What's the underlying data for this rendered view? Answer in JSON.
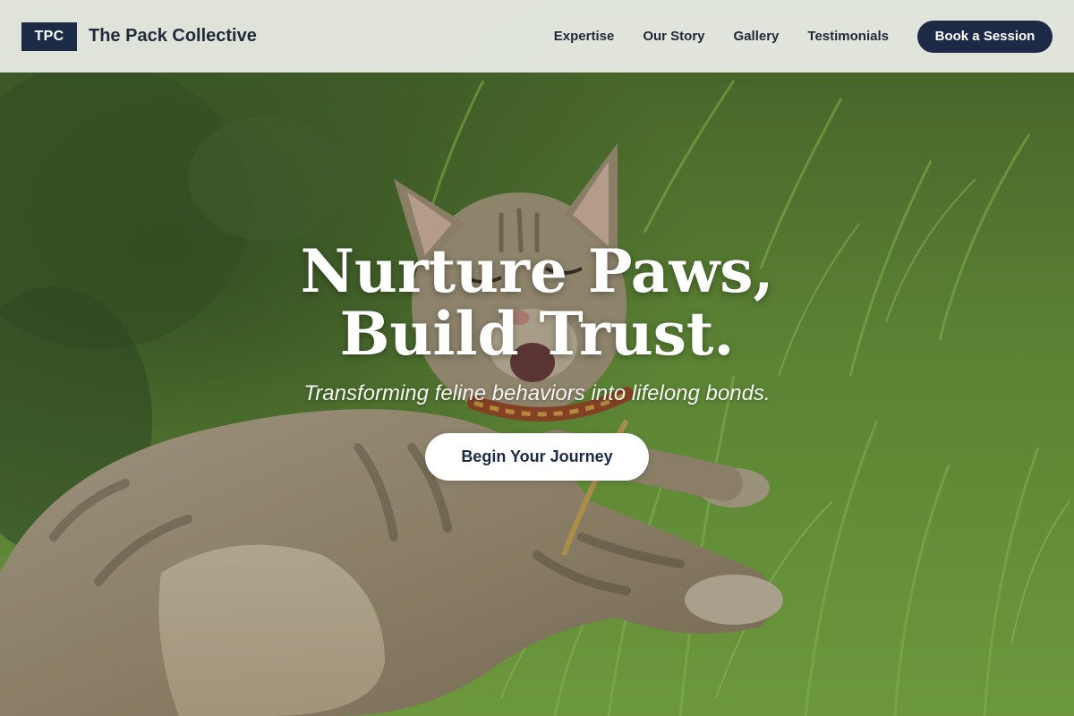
{
  "header": {
    "logo_badge": "TPC",
    "brand_name": "The Pack Collective",
    "nav": [
      {
        "label": "Expertise"
      },
      {
        "label": "Our Story"
      },
      {
        "label": "Gallery"
      },
      {
        "label": "Testimonials"
      }
    ],
    "cta_label": "Book a Session"
  },
  "hero": {
    "title_line1": "Nurture Paws,",
    "title_line2": "Build Trust.",
    "subtitle": "Transforming feline behaviors into lifelong bonds.",
    "button_label": "Begin Your Journey",
    "image": "tabby-cat-lying-in-grass"
  },
  "colors": {
    "brand_navy": "#1c2a45",
    "header_bg": "#eceee8",
    "text_dark": "#1f2937",
    "white": "#ffffff"
  }
}
